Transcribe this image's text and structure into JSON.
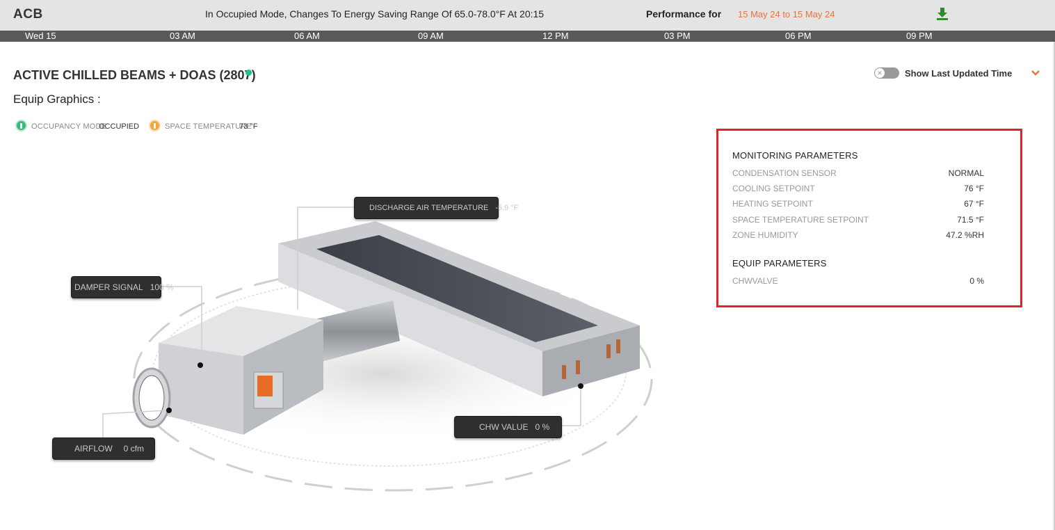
{
  "topbar": {
    "app_name": "ACB",
    "message": "In Occupied Mode, Changes To Energy Saving Range Of 65.0-78.0°F At 20:15",
    "performance_label": "Performance for",
    "date_range": "15 May 24 to 15 May 24",
    "download_icon": "download-icon"
  },
  "timeline": [
    "Wed 15",
    "03 AM",
    "06 AM",
    "09 AM",
    "12 PM",
    "03 PM",
    "06 PM",
    "09 PM"
  ],
  "equip": {
    "title": "ACTIVE CHILLED BEAMS + DOAS (2807)",
    "status_color": "#1cc48a",
    "graphics_label": "Equip Graphics :"
  },
  "toggle": {
    "label": "Show Last Updated Time",
    "on": false
  },
  "status_chips": [
    {
      "label": "OCCUPANCY MODE",
      "value": "OCCUPIED",
      "color": "#3cb878",
      "icon": "person-icon"
    },
    {
      "label": "SPACE TEMPERATURE",
      "value": "73 °F",
      "color": "#f2a53a",
      "icon": "thermometer-icon"
    }
  ],
  "tags": {
    "discharge": {
      "label": "DISCHARGE AIR TEMPERATURE",
      "value": "-5.9 °F"
    },
    "damper": {
      "label": "DAMPER SIGNAL",
      "value": "100 %"
    },
    "airflow": {
      "label": "AIRFLOW",
      "value": "0 cfm"
    },
    "chw": {
      "label": "CHW VALUE",
      "value": "0 %"
    }
  },
  "panel": {
    "monitoring_title": "MONITORING PARAMETERS",
    "monitoring": [
      {
        "name": "CONDENSATION SENSOR",
        "value": "NORMAL"
      },
      {
        "name": "COOLING SETPOINT",
        "value": "76 °F"
      },
      {
        "name": "HEATING SETPOINT",
        "value": "67 °F"
      },
      {
        "name": "SPACE TEMPERATURE SETPOINT",
        "value": "71.5 °F"
      },
      {
        "name": "ZONE HUMIDITY",
        "value": "47.2 %RH"
      }
    ],
    "equip_title": "EQUIP PARAMETERS",
    "equip": [
      {
        "name": "CHWVALVE",
        "value": "0 %"
      }
    ],
    "border_color": "#e0232e"
  },
  "colors": {
    "accent": "#e8733a",
    "download": "#2e8b2e"
  }
}
